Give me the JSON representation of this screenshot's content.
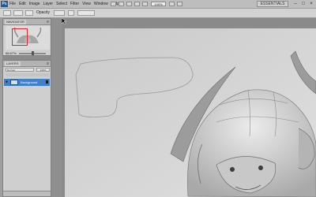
{
  "app": {
    "logo": "Ps"
  },
  "menubar": {
    "items": [
      "File",
      "Edit",
      "Image",
      "Layer",
      "Select",
      "Filter",
      "View",
      "Window",
      "Help"
    ],
    "zoom": "100%",
    "workspace": "ESSENTIALS",
    "window_controls": [
      "–",
      "□",
      "×"
    ]
  },
  "options": {
    "label": "Opacity"
  },
  "navigator": {
    "tab": "NAVIGATOR",
    "zoom": "66.67%"
  },
  "layers": {
    "tab": "LAYERS",
    "blend_mode": "Normal",
    "opacity": "100%",
    "layer_name": "Background"
  },
  "colors": {
    "accent": "#3e7fce",
    "panel": "#cfcfcf",
    "canvas_bg": "#8a8a8a",
    "paper": "#dadada",
    "proxy": "#d8282f"
  },
  "icons": [
    "photoshop-logo",
    "eye-icon",
    "lock-icon",
    "cursor-icon"
  ]
}
